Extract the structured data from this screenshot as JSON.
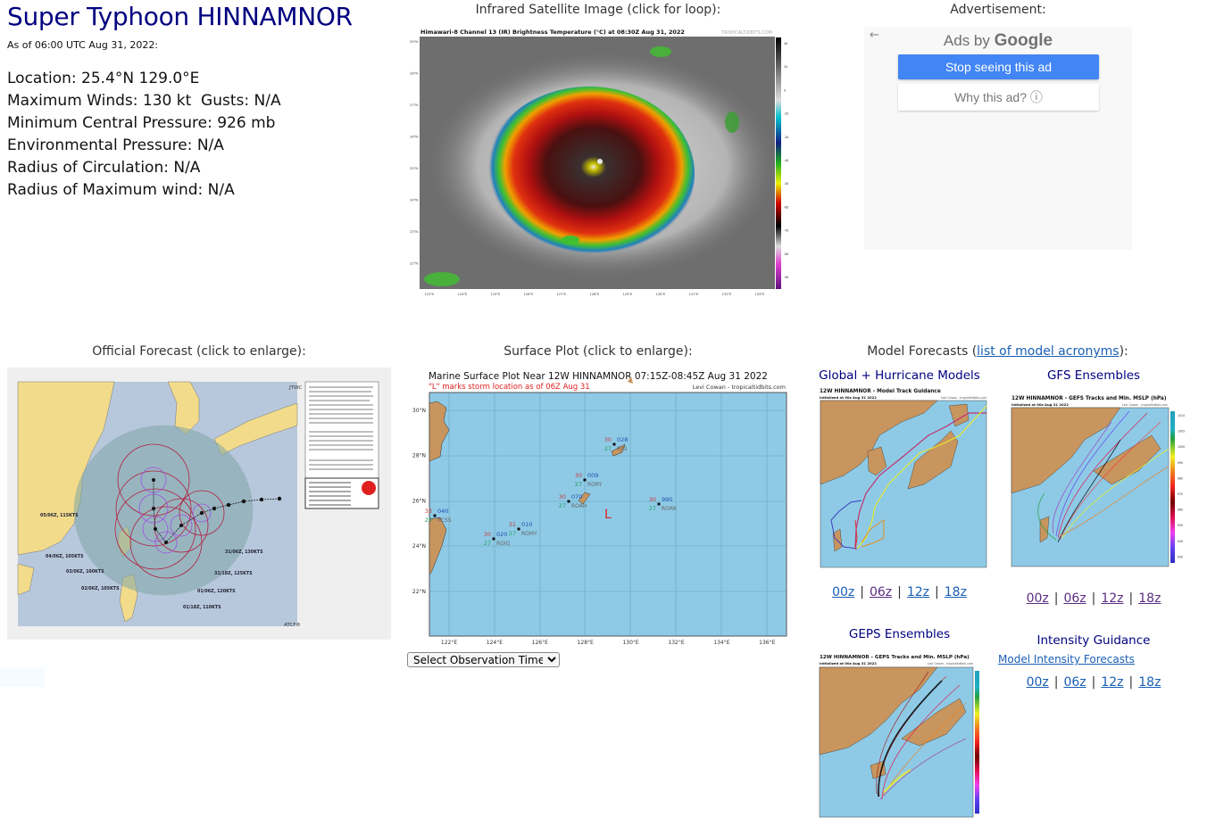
{
  "storm": {
    "title": "Super Typhoon HINNAMNOR",
    "as_of": "As of 06:00 UTC Aug 31, 2022:",
    "details": [
      "Location: 25.4°N 129.0°E",
      "Maximum Winds: 130 kt  Gusts: N/A",
      "Minimum Central Pressure: 926 mb",
      "Environmental Pressure: N/A",
      "Radius of Circulation: N/A",
      "Radius of Maximum wind: N/A"
    ]
  },
  "satellite": {
    "heading": "Infrared Satellite Image (click for loop):",
    "image_title": "Himawari-8 Channel 13 (IR) Brightness Temperature (°C) at 08:30Z Aug 31, 2022",
    "watermark": "TROPICALTIDBITS.COM",
    "lat_labels": [
      "29°N",
      "28°N",
      "27°N",
      "26°N",
      "25°N",
      "24°N",
      "23°N",
      "22°N"
    ],
    "lon_labels": [
      "123°E",
      "124°E",
      "125°E",
      "126°E",
      "127°E",
      "128°E",
      "129°E",
      "130°E",
      "131°E",
      "132°E",
      "133°E"
    ],
    "colorbar_labels": [
      "40",
      "20",
      "0",
      "-20",
      "-30",
      "-40",
      "-50",
      "-60",
      "-70",
      "-80",
      "-90"
    ]
  },
  "ad": {
    "heading": "Advertisement:",
    "back_icon": "←",
    "ads_by": "Ads by",
    "google": "Google",
    "stop_label": "Stop seeing this ad",
    "why_label": "Why this ad?",
    "info_icon": "ⓘ"
  },
  "official": {
    "heading": "Official Forecast (click to enlarge):",
    "corner_top": "JTWC",
    "corner_bottom": "ATCF®",
    "forecast_labels": [
      "05/06Z, 115KTS",
      "04/06Z, 105KTS",
      "03/06Z, 100KTS",
      "02/06Z, 105KTS",
      "31/06Z, 130KTS",
      "31/18Z, 125KTS",
      "01/06Z, 120KTS",
      "01/18Z, 110KTS"
    ]
  },
  "surface": {
    "heading": "Surface Plot (click to enlarge):",
    "image_title": "Marine Surface Plot Near 12W HINNAMNOR 07:15Z-08:45Z Aug 31 2022",
    "subtitle": "\"L\" marks storm location as of 06Z Aug 31",
    "credit": "Levi Cowan - tropicaltidbits.com",
    "lat_labels": [
      "30°N",
      "28°N",
      "26°N",
      "24°N",
      "22°N"
    ],
    "lon_labels": [
      "122°E",
      "124°E",
      "126°E",
      "128°E",
      "130°E",
      "132°E",
      "134°E",
      "136°E"
    ],
    "storm_marker": "L",
    "stations": [
      {
        "id": "RJKI",
        "temp": "30",
        "dew": "27",
        "pres": "028"
      },
      {
        "id": "RORY",
        "temp": "30",
        "dew": "27",
        "pres": "009"
      },
      {
        "id": "ROAH",
        "temp": "30",
        "dew": "27",
        "pres": "070"
      },
      {
        "id": "RORK",
        "temp": "30",
        "dew": "27",
        "pres": "990"
      },
      {
        "id": "ROMY",
        "temp": "31",
        "dew": "27",
        "pres": "010"
      },
      {
        "id": "ROIG",
        "temp": "30",
        "dew": "27",
        "pres": "020"
      },
      {
        "id": "RCSS",
        "temp": "33",
        "dew": "25",
        "pres": "040"
      }
    ],
    "select_placeholder": "Select Observation Time..."
  },
  "models": {
    "heading_prefix": "Model Forecasts (",
    "heading_link": "list of model acronyms",
    "heading_suffix": "):",
    "global": {
      "title": "Global + Hurricane Models",
      "image_title": "12W HINNAMNOR - Model Track Guidance",
      "init": "Initialized at 00z Aug 31 2022",
      "credit": "Levi Cowan - tropicaltidbits.com",
      "runs": [
        "00z",
        "06z",
        "12z",
        "18z"
      ]
    },
    "gfs": {
      "title": "GFS Ensembles",
      "image_title": "12W HINNAMNOR - GEFS Tracks and Min. MSLP (hPa)",
      "init": "Initialized at 00z Aug 31 2022",
      "credit": "Levi Cowan - tropicaltidbits.com",
      "runs": [
        "00z",
        "06z",
        "12z",
        "18z"
      ],
      "colorbar_labels": [
        "1010",
        "1005",
        "1000",
        "990",
        "980",
        "970",
        "960",
        "950",
        "940",
        "930"
      ]
    },
    "geps": {
      "title": "GEPS Ensembles",
      "image_title": "12W HINNAMNOR - GEPS Tracks and Min. MSLP (hPa)",
      "init": "Initialized at 00z Aug 31 2022",
      "credit": "Levi Cowan - tropicaltidbits.com"
    },
    "intensity": {
      "title": "Intensity Guidance",
      "link": "Model Intensity Forecasts",
      "runs": [
        "00z",
        "06z",
        "12z",
        "18z"
      ]
    },
    "separator": "|"
  },
  "colors": {
    "title_navy": "#000080",
    "link_blue": "#1a5fb4",
    "link_visited": "#5b2d82",
    "ad_blue": "#4285f4",
    "ocean": "#8ecae6",
    "land": "#c8955e"
  }
}
